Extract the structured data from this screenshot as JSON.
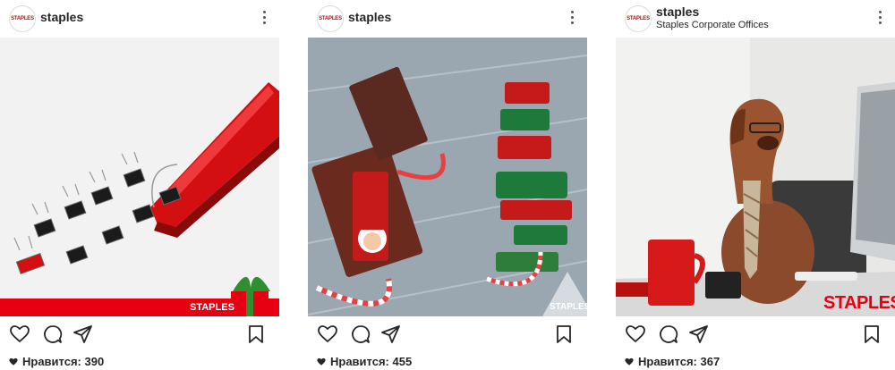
{
  "posts": [
    {
      "username": "staples",
      "avatar_text": "STAPLES",
      "location": "",
      "image_logo": "STAPLES",
      "likes_label": "Нравится: 390"
    },
    {
      "username": "staples",
      "avatar_text": "STAPLES",
      "location": "",
      "image_logo": "STAPLES",
      "likes_label": "Нравится: 455"
    },
    {
      "username": "staples",
      "avatar_text": "STAPLES",
      "location": "Staples Corporate Offices",
      "image_logo": "STAPLES",
      "likes_label": "Нравится: 367"
    }
  ],
  "icons": [
    "heart-icon",
    "comment-icon",
    "share-icon",
    "bookmark-icon",
    "more-options-icon"
  ],
  "colors": {
    "brand_red": "#cc0000",
    "text": "#262626"
  }
}
